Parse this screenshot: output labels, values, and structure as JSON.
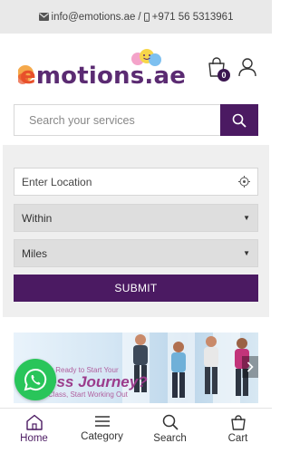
{
  "topbar": {
    "email": "info@emotions.ae",
    "separator": "/",
    "phone": "+971 56 5313961"
  },
  "header": {
    "logo_text_first": "e",
    "logo_text_rest": "motions.ae",
    "cart_count": "0"
  },
  "search": {
    "placeholder": "Search your services"
  },
  "filter": {
    "location_placeholder": "Enter Location",
    "within_value": "Within",
    "miles_value": "Miles",
    "submit_label": "SUBMIT"
  },
  "banner": {
    "line1": "y Ready to Start Your",
    "line2": "ess Journey?",
    "line3": "Class, Start Working Out"
  },
  "bottom_nav": {
    "items": [
      {
        "label": "Home",
        "icon": "home-icon"
      },
      {
        "label": "Category",
        "icon": "menu-icon"
      },
      {
        "label": "Search",
        "icon": "search-icon"
      },
      {
        "label": "Cart",
        "icon": "cart-icon"
      }
    ]
  },
  "colors": {
    "brand_purple": "#4b1a62",
    "whatsapp_green": "#29c55a"
  }
}
